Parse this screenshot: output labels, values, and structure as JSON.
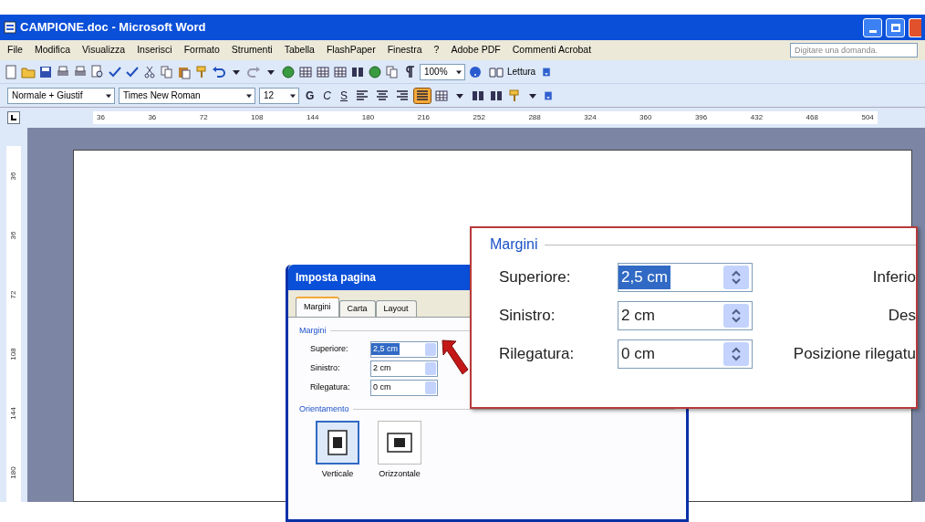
{
  "window": {
    "title": "CAMPIONE.doc - Microsoft Word"
  },
  "menu": [
    {
      "label": "File"
    },
    {
      "label": "Modifica"
    },
    {
      "label": "Visualizza"
    },
    {
      "label": "Inserisci"
    },
    {
      "label": "Formato"
    },
    {
      "label": "Strumenti"
    },
    {
      "label": "Tabella"
    },
    {
      "label": "FlashPaper"
    },
    {
      "label": "Finestra"
    },
    {
      "label": "?"
    },
    {
      "label": "Adobe PDF"
    },
    {
      "label": "Commenti Acrobat"
    }
  ],
  "help_field": {
    "placeholder": "Digitare una domanda."
  },
  "standard_toolbar": {
    "zoom": "100%",
    "reading": "Lettura"
  },
  "formatting_toolbar": {
    "style": "Normale + Giustif",
    "font": "Times New Roman",
    "size": "12",
    "text_buttons": [
      "G",
      "C",
      "S"
    ],
    "alignments": [
      {
        "kind": "left",
        "selected": false
      },
      {
        "kind": "center",
        "selected": false
      },
      {
        "kind": "right",
        "selected": false
      },
      {
        "kind": "justify",
        "selected": true
      }
    ]
  },
  "ruler": {
    "labels": [
      "36",
      "36",
      "72",
      "108",
      "144",
      "180",
      "216",
      "252",
      "288",
      "324",
      "360",
      "396",
      "432",
      "468",
      "504"
    ]
  },
  "vertical_ruler": {
    "labels": [
      "36",
      "36",
      "72",
      "108",
      "144",
      "180"
    ]
  },
  "dialog": {
    "title": "Imposta pagina",
    "tabs": [
      {
        "label": "Margini",
        "selected": true
      },
      {
        "label": "Carta",
        "selected": false
      },
      {
        "label": "Layout",
        "selected": false
      }
    ],
    "group": "Margini",
    "fields": [
      {
        "label": "Superiore:",
        "value": "2,5 cm",
        "selected": true
      },
      {
        "label": "Sinistro:",
        "value": "2 cm",
        "selected": false
      },
      {
        "label": "Rilegatura:",
        "value": "0 cm",
        "selected": false
      }
    ],
    "orientation": {
      "label": "Orientamento",
      "options": [
        {
          "label": "Verticale",
          "kind": "portrait",
          "selected": true
        },
        {
          "label": "Orizzontale",
          "kind": "landscape",
          "selected": false
        }
      ]
    }
  },
  "callout": {
    "group": "Margini",
    "rows": [
      {
        "label": "Superiore:",
        "value": "2,5 cm",
        "selected": true,
        "right_label": "Inferio"
      },
      {
        "label": "Sinistro:",
        "value": "2 cm",
        "selected": false,
        "right_label": "Des"
      },
      {
        "label": "Rilegatura:",
        "value": "0 cm",
        "selected": false,
        "right_label": "Posizione rilegatu"
      }
    ]
  }
}
